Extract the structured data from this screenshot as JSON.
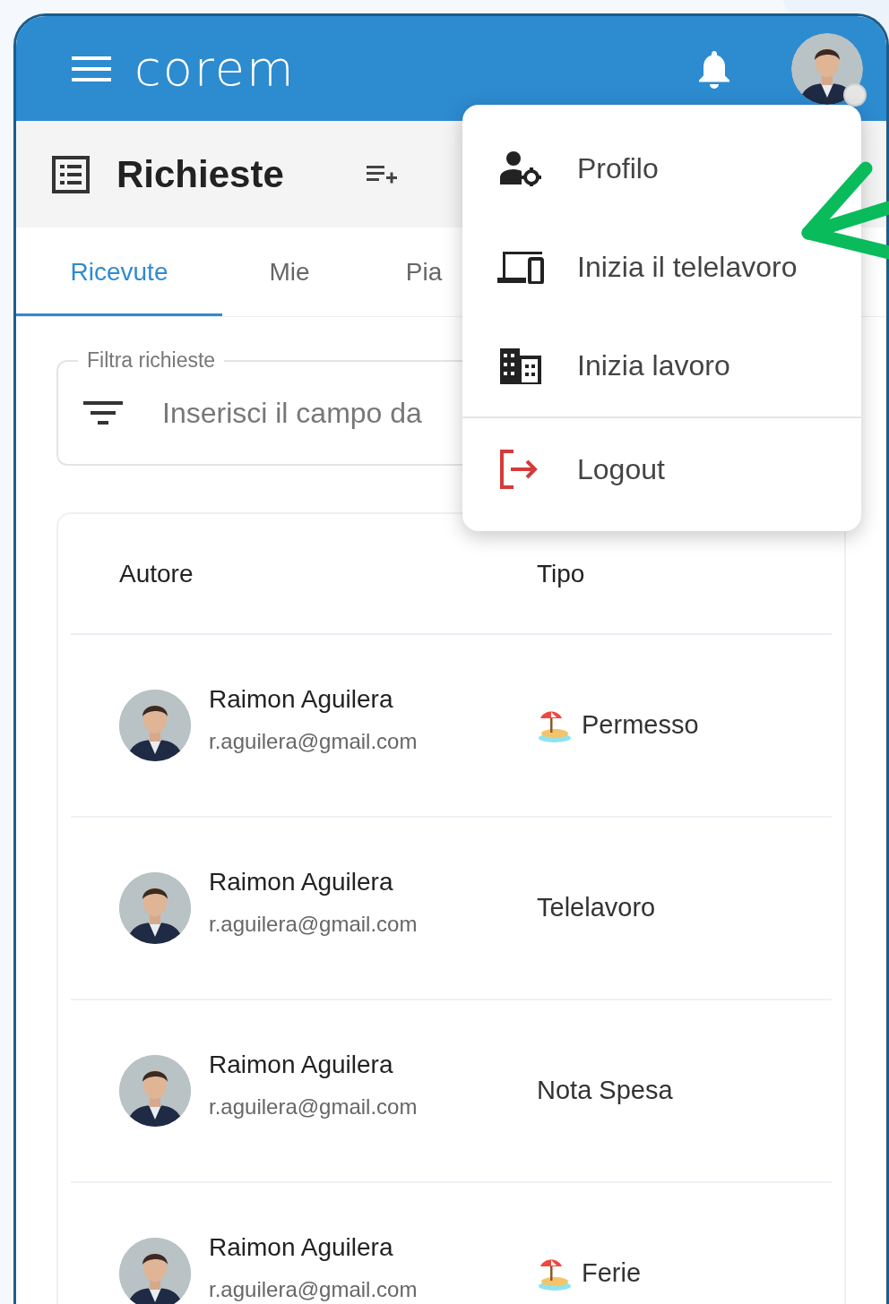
{
  "app_bar": {
    "logo": "corem",
    "avatar_status": true
  },
  "page_header": {
    "title": "Richieste"
  },
  "tabs": [
    {
      "label": "Ricevute",
      "selected": true
    },
    {
      "label": "Mie",
      "selected": false
    },
    {
      "label": "Pia",
      "selected": false
    }
  ],
  "filter": {
    "label": "Filtra richieste",
    "placeholder": "Inserisci il campo da"
  },
  "table": {
    "columns": [
      "Autore",
      "Tipo"
    ],
    "rows": [
      {
        "name": "Raimon Aguilera",
        "email": "r.aguilera@gmail.com",
        "type": "Permesso",
        "type_icon": true
      },
      {
        "name": "Raimon Aguilera",
        "email": "r.aguilera@gmail.com",
        "type": "Telelavoro",
        "type_icon": false
      },
      {
        "name": "Raimon Aguilera",
        "email": "r.aguilera@gmail.com",
        "type": "Nota Spesa",
        "type_icon": false
      },
      {
        "name": "Raimon Aguilera",
        "email": "r.aguilera@gmail.com",
        "type": "Ferie",
        "type_icon": true
      }
    ]
  },
  "user_menu": {
    "items": [
      {
        "label": "Profilo",
        "kind": "profile"
      },
      {
        "label": "Inizia il telelavoro",
        "kind": "remote"
      },
      {
        "label": "Inizia lavoro",
        "kind": "office"
      },
      {
        "label": "Logout",
        "kind": "logout"
      }
    ]
  }
}
